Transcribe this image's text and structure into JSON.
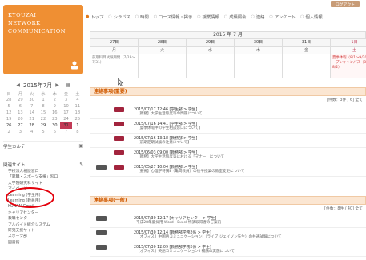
{
  "brand": {
    "line1": "KYOUZAI",
    "line2": "NETWORK",
    "line3": "COMMUNICATION"
  },
  "header": {
    "logout_label": "ログアウト"
  },
  "tabs": [
    {
      "label": "トップ",
      "active": true
    },
    {
      "label": "シラバス",
      "active": false
    },
    {
      "label": "時間",
      "active": false
    },
    {
      "label": "コース情報・掲示",
      "active": false
    },
    {
      "label": "授業情報",
      "active": false
    },
    {
      "label": "成績照会",
      "active": false
    },
    {
      "label": "連絡",
      "active": false
    },
    {
      "label": "アンケート",
      "active": false
    },
    {
      "label": "個人情報",
      "active": false
    }
  ],
  "mini_calendar": {
    "title": "2015年7月",
    "prev_icon": "triangle-left",
    "next_icon": "triangle-right",
    "dow": [
      "日",
      "月",
      "火",
      "水",
      "木",
      "金",
      "土"
    ],
    "weeks": [
      [
        "28",
        "29",
        "30",
        "1",
        "2",
        "3",
        "4"
      ],
      [
        "5",
        "6",
        "7",
        "8",
        "9",
        "10",
        "11"
      ],
      [
        "12",
        "13",
        "14",
        "15",
        "16",
        "17",
        "18"
      ],
      [
        "19",
        "20",
        "21",
        "22",
        "23",
        "24",
        "25"
      ],
      [
        "26",
        "27",
        "28",
        "29",
        "30",
        "31",
        "1"
      ],
      [
        "2",
        "3",
        "4",
        "5",
        "6",
        "7",
        "8"
      ]
    ],
    "today": "31"
  },
  "student_card": {
    "label": "学生カルテ"
  },
  "links": {
    "title": "関連サイト",
    "items": [
      "学校法人相談窓口",
      "「就職・スポーツ支援」窓口",
      "大学院研究科サイト",
      "マイページ",
      "Learning (学生用)",
      "Learning (教員用)",
      "KONAN Gmail",
      "キャリアセンター",
      "教職センター",
      "アルバイト紹介システム",
      "研究支援サイト",
      "スポーツ部",
      "図書館"
    ]
  },
  "week_calendar": {
    "title": "2015 年 7 月",
    "days": [
      {
        "date": "27日",
        "dow": "月",
        "event": "前期科目試験期間（7/28〜7/31）",
        "type": "normal"
      },
      {
        "date": "28日",
        "dow": "火",
        "event": "",
        "type": "normal"
      },
      {
        "date": "29日",
        "dow": "水",
        "event": "",
        "type": "normal"
      },
      {
        "date": "30日",
        "dow": "木",
        "event": "",
        "type": "normal"
      },
      {
        "date": "31日",
        "dow": "金",
        "event": "",
        "type": "normal"
      },
      {
        "date": "1日",
        "dow": "土",
        "event": "夏季休暇（8/1〜9/20）オープンキャンパス（8/1〜8/2）",
        "type": "sat"
      }
    ]
  },
  "important_notices": {
    "title": "連絡事項(重要)",
    "count": "[件数：3件 / 6] 全て",
    "items": [
      {
        "line1": "2015/07/17 12:46 [学生部 > 学生]",
        "line2": "【教務】大学生活態度等の問題について",
        "tag": "red",
        "tag_pos": "l1"
      },
      {
        "line1": "2015/07/16 14:41 [学生部 > 学生]",
        "line2": "【夏季休暇中の学生相談窓口について】",
        "tag": "red",
        "tag_pos": "l1"
      },
      {
        "line1": "2015/07/16 13:18 [教務部 > 学生]",
        "line2": "【前期定期試験の注意について】",
        "tag": "red",
        "tag_pos": "l1"
      },
      {
        "line1": "2015/06/03 09:00 [教務部 > 学生]",
        "line2": "【教務】大学生活態度等における「マナー」について",
        "tag": "red",
        "tag_pos": "l1"
      },
      {
        "line1": "2015/05/27 10:04 [教務部 > 学生]",
        "line2": "【重要】心理学特講Ⅱ（亀岡教員）の後半授業の教室変更について",
        "tag": "dark",
        "tag_pos": "l0"
      }
    ]
  },
  "general_notices": {
    "title": "連絡事項(一般)",
    "count": "[件数：8件 / 40] 全て",
    "items": [
      {
        "line1": "2015/07/30 12:17 [キャリアセンター > 学生]",
        "line2": "平成28年度採用 Word・Excel 特講取得者のご案内",
        "tag": "dark",
        "tag_pos": "l0"
      },
      {
        "line1": "2015/07/30 12:14 [教務部学務2係 > 学生]",
        "line2": "【オフィス】中国語コミュニケーションⅠ（ライブ ジェイソン先生）の共通試験について",
        "tag": "dark",
        "tag_pos": "l0"
      },
      {
        "line1": "2015/07/30 12:09 [教務部学務2係 > 学生]",
        "line2": "【オフィス】英語コミュニケーションⅡ 補講の実施について",
        "tag": "dark",
        "tag_pos": "l0"
      }
    ]
  }
}
